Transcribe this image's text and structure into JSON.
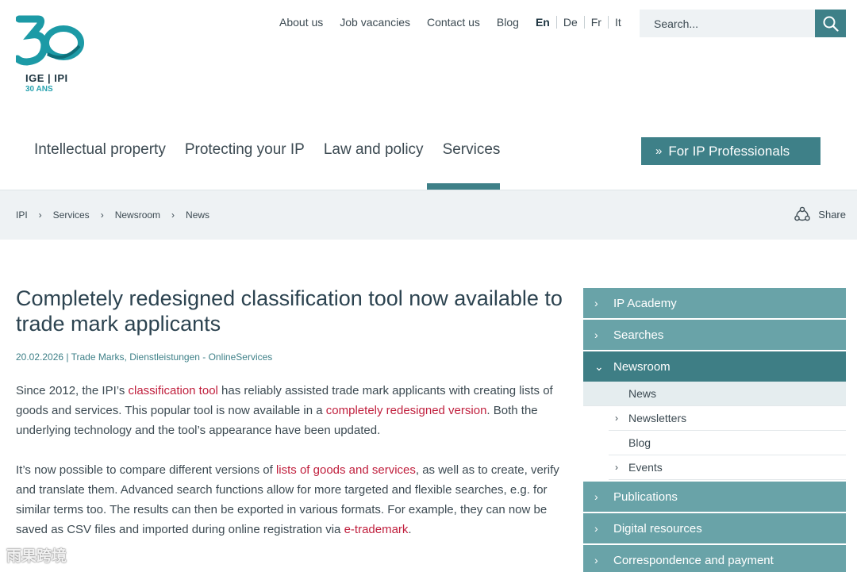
{
  "logo": {
    "text": "IGE | IPI",
    "sub": "30 ANS"
  },
  "topnav": {
    "links": [
      "About us",
      "Job vacancies",
      "Contact us",
      "Blog"
    ],
    "languages": [
      "En",
      "De",
      "Fr",
      "It"
    ]
  },
  "search": {
    "placeholder": "Search..."
  },
  "mainnav": {
    "items": [
      "Intellectual property",
      "Protecting your IP",
      "Law and policy",
      "Services"
    ],
    "pro_button": "For IP Professionals"
  },
  "breadcrumb": {
    "items": [
      "IPI",
      "Services",
      "Newsroom",
      "News"
    ],
    "share": "Share"
  },
  "article": {
    "title": "Completely redesigned classification tool now available to trade mark applicants",
    "meta": "20.02.2026 | Trade Marks, Dienstleistungen - OnlineServices",
    "p1": {
      "t1": "Since 2012, the IPI’s ",
      "l1": "classification tool",
      "t2": " has reliably assisted trade mark applicants with creating lists of goods and services. This popular tool is now available in a ",
      "l2": "completely redesigned version",
      "t3": ". Both the underlying technology and the tool’s appearance have been updated."
    },
    "p2": {
      "t1": "It’s now possible to compare different versions of ",
      "l1": "lists of goods and services",
      "t2": ", as well as to create, verify and translate them. Advanced search functions allow for more targeted and flexible searches, e.g. for similar terms too. The results can then be exported in various formats. For example, they can now be saved as CSV files and imported during online registration via ",
      "l2": "e-trademark",
      "t3": "."
    }
  },
  "sidebar": {
    "items": [
      "IP Academy",
      "Searches",
      "Newsroom"
    ],
    "sub": [
      "News",
      "Newsletters",
      "Blog",
      "Events"
    ],
    "items_after": [
      "Publications",
      "Digital resources",
      "Correspondence and payment"
    ]
  },
  "watermark": "雨果跨境",
  "colors": {
    "accent": "#3e8088",
    "link": "#c01f3d",
    "sidebar": "#69a3a8"
  }
}
